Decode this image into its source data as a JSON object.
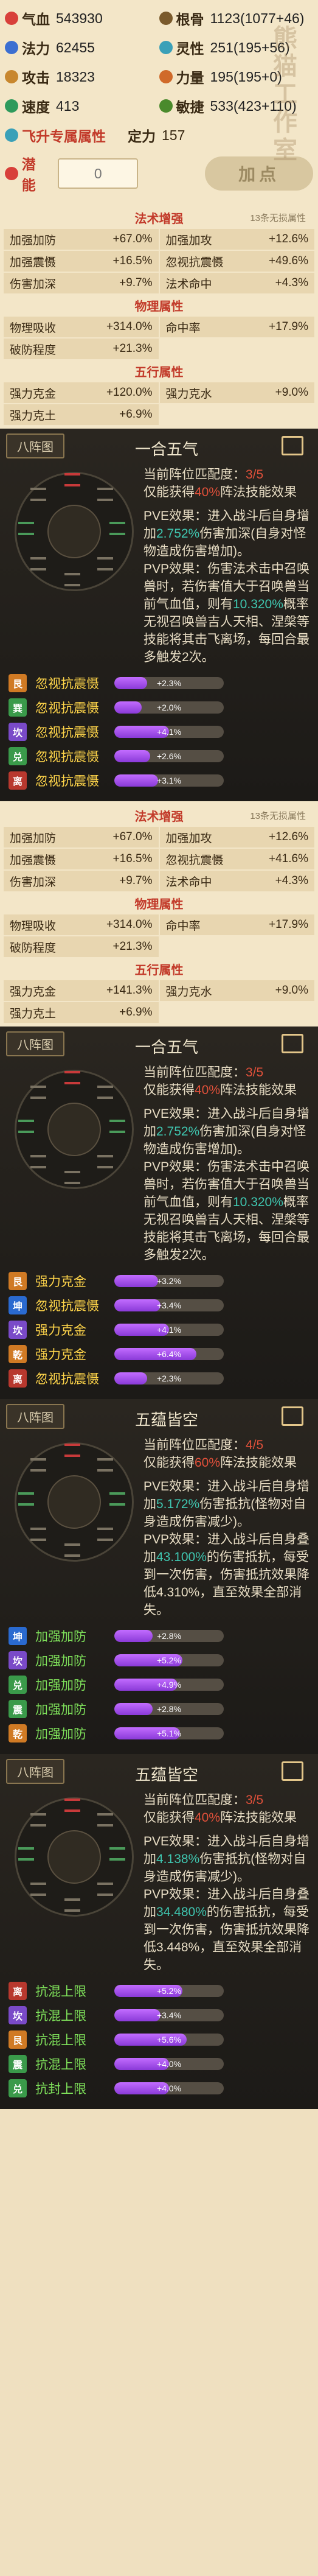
{
  "stats": {
    "row1": [
      {
        "label": "气血",
        "value": "543930"
      },
      {
        "label": "根骨",
        "value": "1123(1077+46)"
      }
    ],
    "row2": [
      {
        "label": "法力",
        "value": "62455"
      },
      {
        "label": "灵性",
        "value": "251(195+56)"
      }
    ],
    "row3": [
      {
        "label": "攻击",
        "value": "18323"
      },
      {
        "label": "力量",
        "value": "195(195+0)"
      }
    ],
    "row4": [
      {
        "label": "速度",
        "value": "413"
      },
      {
        "label": "敏捷",
        "value": "533(423+110)"
      }
    ],
    "feisheng": {
      "label": "飞升专属属性",
      "ding_label": "定力",
      "ding_value": "157"
    },
    "potential": {
      "label": "潜能",
      "value": "0",
      "add_button": "加点"
    }
  },
  "attr_top": {
    "fashu": {
      "title": "法术增强",
      "note": "13条无损属性",
      "cells": [
        [
          "加强加防",
          "+67.0%"
        ],
        [
          "加强加攻",
          "+12.6%"
        ],
        [
          "加强震慑",
          "+16.5%"
        ],
        [
          "忽视抗震慑",
          "+49.6%"
        ],
        [
          "伤害加深",
          "+9.7%"
        ],
        [
          "法术命中",
          "+4.3%"
        ]
      ]
    },
    "wuli": {
      "title": "物理属性",
      "cells": [
        [
          "物理吸收",
          "+314.0%"
        ],
        [
          "命中率",
          "+17.9%"
        ],
        [
          "破防程度",
          "+21.3%"
        ]
      ]
    },
    "wuxing": {
      "title": "五行属性",
      "cells": [
        [
          "强力克金",
          "+120.0%"
        ],
        [
          "强力克水",
          "+9.0%"
        ],
        [
          "强力克土",
          "+6.9%"
        ]
      ]
    }
  },
  "zhen1": {
    "tab": "八阵图",
    "name": "一合五气",
    "desc": {
      "pos_pre": "当前阵位匹配度：",
      "pos_val": "3/5",
      "gain_pre": "仅能获得",
      "gain_val": "40%",
      "gain_post": "阵法技能效果",
      "pve": "PVE效果：进入战斗后自身增加",
      "pve_val": "2.752%",
      "pve_post": "伤害加深(自身对怪物造成伤害增加)。",
      "pvp": "PVP效果：伤害法术击中召唤兽时，若伤害值大于召唤兽当前气血值，则有",
      "pvp_val": "10.320%",
      "pvp_post": "概率无视召唤兽吉人天相、涅槃等技能将其击飞离场，每回合最多触发2次。"
    },
    "rows": [
      {
        "badge": "艮",
        "name": "忽视抗震慑",
        "bar": "+2.3%",
        "pct": 0.3
      },
      {
        "badge": "巽",
        "name": "忽视抗震慑",
        "bar": "+2.0%",
        "pct": 0.25
      },
      {
        "badge": "坎",
        "name": "忽视抗震慑",
        "bar": "+4.1%",
        "pct": 0.5
      },
      {
        "badge": "兑",
        "name": "忽视抗震慑",
        "bar": "+2.6%",
        "pct": 0.33
      },
      {
        "badge": "离",
        "name": "忽视抗震慑",
        "bar": "+3.1%",
        "pct": 0.4
      }
    ]
  },
  "attr_mid": {
    "fashu": {
      "title": "法术增强",
      "note": "13条无损属性",
      "cells": [
        [
          "加强加防",
          "+67.0%"
        ],
        [
          "加强加攻",
          "+12.6%"
        ],
        [
          "加强震慑",
          "+16.5%"
        ],
        [
          "忽视抗震慑",
          "+41.6%"
        ],
        [
          "伤害加深",
          "+9.7%"
        ],
        [
          "法术命中",
          "+4.3%"
        ]
      ]
    },
    "wuli": {
      "title": "物理属性",
      "cells": [
        [
          "物理吸收",
          "+314.0%"
        ],
        [
          "命中率",
          "+17.9%"
        ],
        [
          "破防程度",
          "+21.3%"
        ]
      ]
    },
    "wuxing": {
      "title": "五行属性",
      "cells": [
        [
          "强力克金",
          "+141.3%"
        ],
        [
          "强力克水",
          "+9.0%"
        ],
        [
          "强力克土",
          "+6.9%"
        ]
      ]
    }
  },
  "zhen2": {
    "tab": "八阵图",
    "name": "一合五气",
    "desc": {
      "pos_pre": "当前阵位匹配度：",
      "pos_val": "3/5",
      "gain_pre": "仅能获得",
      "gain_val": "40%",
      "gain_post": "阵法技能效果",
      "pve": "PVE效果：进入战斗后自身增加",
      "pve_val": "2.752%",
      "pve_post": "伤害加深(自身对怪物造成伤害增加)。",
      "pvp": "PVP效果：伤害法术击中召唤兽时，若伤害值大于召唤兽当前气血值，则有",
      "pvp_val": "10.320%",
      "pvp_post": "概率无视召唤兽吉人天相、涅槃等技能将其击飞离场，每回合最多触发2次。"
    },
    "rows": [
      {
        "badge": "艮",
        "name": "强力克金",
        "bar": "+3.2%",
        "pct": 0.4
      },
      {
        "badge": "坤",
        "name": "忽视抗震慑",
        "bar": "+3.4%",
        "pct": 0.42
      },
      {
        "badge": "坎",
        "name": "强力克金",
        "bar": "+4.1%",
        "pct": 0.5
      },
      {
        "badge": "乾",
        "name": "强力克金",
        "bar": "+6.4%",
        "pct": 0.75
      },
      {
        "badge": "离",
        "name": "忽视抗震慑",
        "bar": "+2.3%",
        "pct": 0.3
      }
    ]
  },
  "zhen3": {
    "tab": "八阵图",
    "name": "五蕴皆空",
    "desc": {
      "pos_pre": "当前阵位匹配度：",
      "pos_val": "4/5",
      "gain_pre": "仅能获得",
      "gain_val": "60%",
      "gain_post": "阵法技能效果",
      "pve": "PVE效果：进入战斗后自身增加",
      "pve_val": "5.172%",
      "pve_post": "伤害抵抗(怪物对自身造成伤害减少)。",
      "pvp": "PVP效果：进入战斗后自身叠加",
      "pvp_val": "43.100%",
      "pvp_post": "的伤害抵抗，每受到一次伤害，伤害抵抗效果降低4.310%，直至效果全部消失。"
    },
    "rows": [
      {
        "badge": "坤",
        "name": "加强加防",
        "bar": "+2.8%",
        "pct": 0.35
      },
      {
        "badge": "坎",
        "name": "加强加防",
        "bar": "+5.2%",
        "pct": 0.62
      },
      {
        "badge": "兑",
        "name": "加强加防",
        "bar": "+4.9%",
        "pct": 0.58
      },
      {
        "badge": "震",
        "name": "加强加防",
        "bar": "+2.8%",
        "pct": 0.35
      },
      {
        "badge": "乾",
        "name": "加强加防",
        "bar": "+5.1%",
        "pct": 0.6
      }
    ]
  },
  "zhen4": {
    "tab": "八阵图",
    "name": "五蕴皆空",
    "desc": {
      "pos_pre": "当前阵位匹配度：",
      "pos_val": "3/5",
      "gain_pre": "仅能获得",
      "gain_val": "40%",
      "gain_post": "阵法技能效果",
      "pve": "PVE效果：进入战斗后自身增加",
      "pve_val": "4.138%",
      "pve_post": "伤害抵抗(怪物对自身造成伤害减少)。",
      "pvp": "PVP效果：进入战斗后自身叠加",
      "pvp_val": "34.480%",
      "pvp_post": "的伤害抵抗，每受到一次伤害，伤害抵抗效果降低3.448%，直至效果全部消失。"
    },
    "rows": [
      {
        "badge": "离",
        "name": "抗混上限",
        "bar": "+5.2%",
        "pct": 0.62
      },
      {
        "badge": "坎",
        "name": "抗混上限",
        "bar": "+3.4%",
        "pct": 0.42
      },
      {
        "badge": "艮",
        "name": "抗混上限",
        "bar": "+5.6%",
        "pct": 0.66
      },
      {
        "badge": "震",
        "name": "抗混上限",
        "bar": "+4.0%",
        "pct": 0.5
      },
      {
        "badge": "兑",
        "name": "抗封上限",
        "bar": "+4.0%",
        "pct": 0.5
      }
    ]
  },
  "watermark": "熊猫工作室"
}
